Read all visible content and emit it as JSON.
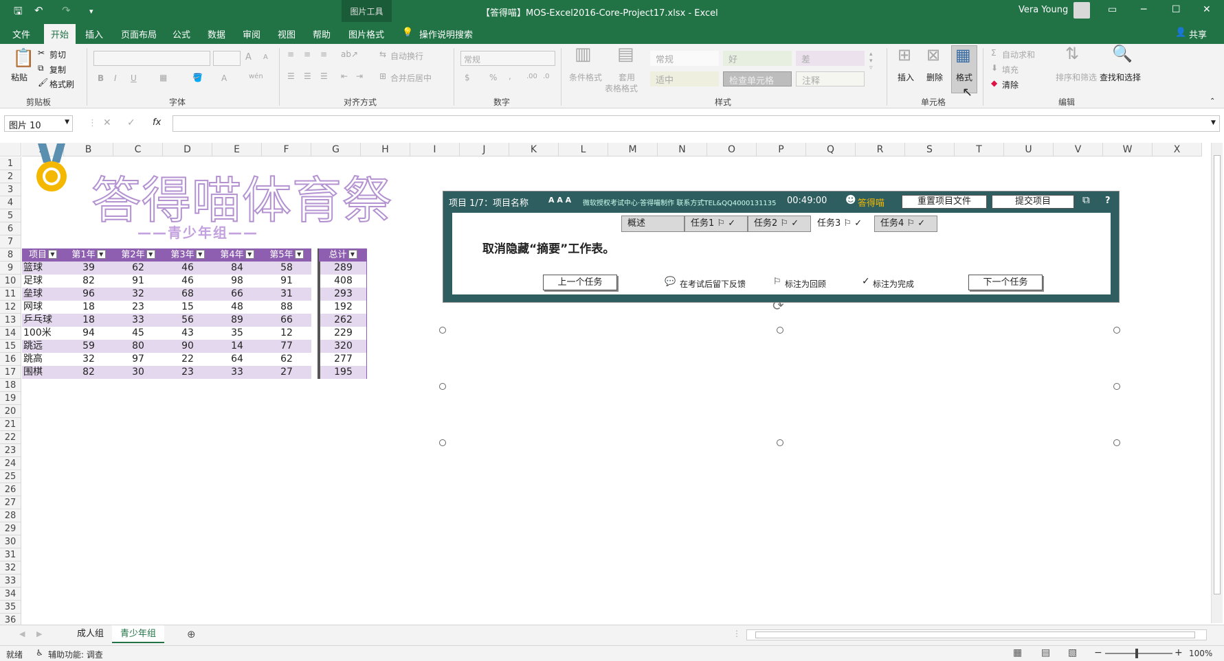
{
  "qat": {
    "save_icon": "save-icon",
    "undo_icon": "undo-icon",
    "redo_icon": "redo-icon",
    "customize": "▾"
  },
  "context_tab": {
    "label": "图片工具"
  },
  "document_title": "【答得喵】MOS-Excel2016-Core-Project17.xlsx  -  Excel",
  "user": {
    "name": "Vera Young"
  },
  "ribbon_tabs": [
    "文件",
    "开始",
    "插入",
    "页面布局",
    "公式",
    "数据",
    "审阅",
    "视图",
    "帮助",
    "图片格式"
  ],
  "tell_me": "操作说明搜索",
  "share": "共享",
  "clipboard": {
    "paste": "粘贴",
    "cut": "剪切",
    "copy": "复制",
    "format_painter": "格式刷",
    "group": "剪贴板"
  },
  "font": {
    "group": "字体",
    "bold": "B",
    "italic": "I",
    "underline": "U",
    "grow": "A",
    "shrink": "A",
    "color": "A",
    "phonetic": "wén"
  },
  "alignment": {
    "wrap": "自动换行",
    "merge": "合并后居中",
    "group": "对齐方式"
  },
  "number": {
    "format": "常规",
    "currency": "$",
    "percent": "%",
    "comma": ",",
    "group": "数字"
  },
  "styles": {
    "conditional": "条件格式",
    "table1": "套用",
    "table2": "表格格式",
    "group": "样式",
    "normal": "常规",
    "good": "好",
    "bad": "差",
    "neutral": "适中",
    "check": "检查单元格",
    "note": "注释"
  },
  "cells": {
    "insert": "插入",
    "delete": "删除",
    "format": "格式",
    "group": "单元格"
  },
  "editing": {
    "autosum": "自动求和",
    "fill": "填充",
    "clear": "清除",
    "sort": "排序和筛选",
    "find": "查找和选择",
    "group": "编辑"
  },
  "formula_bar": {
    "name_box": "图片 10",
    "fx": "fx",
    "cancel": "✕",
    "enter": "✓",
    "value": ""
  },
  "columns": [
    "A",
    "B",
    "C",
    "D",
    "E",
    "F",
    "G",
    "H",
    "I",
    "J",
    "K",
    "L",
    "M",
    "N",
    "O",
    "P",
    "Q",
    "R",
    "S",
    "T",
    "U",
    "V",
    "W",
    "X"
  ],
  "rows": [
    "1",
    "2",
    "3",
    "4",
    "5",
    "6",
    "7",
    "8",
    "9",
    "10",
    "11",
    "12",
    "13",
    "14",
    "15",
    "16",
    "17",
    "18",
    "19",
    "20",
    "21",
    "22",
    "23",
    "24",
    "25",
    "26",
    "27",
    "28",
    "29",
    "30",
    "31",
    "32",
    "33",
    "34",
    "35",
    "36"
  ],
  "banner": {
    "title": "答得喵体育祭",
    "subtitle": "——青少年组——",
    "medal_icon": "medal-icon"
  },
  "table": {
    "headers": [
      "项目",
      "第1年",
      "第2年",
      "第3年",
      "第4年",
      "第5年",
      "总计"
    ],
    "rows": [
      [
        "篮球",
        "39",
        "62",
        "46",
        "84",
        "58",
        "289"
      ],
      [
        "足球",
        "82",
        "91",
        "46",
        "98",
        "91",
        "408"
      ],
      [
        "垒球",
        "96",
        "32",
        "68",
        "66",
        "31",
        "293"
      ],
      [
        "网球",
        "18",
        "23",
        "15",
        "48",
        "88",
        "192"
      ],
      [
        "乒乓球",
        "18",
        "33",
        "56",
        "89",
        "66",
        "262"
      ],
      [
        "100米",
        "94",
        "45",
        "43",
        "35",
        "12",
        "229"
      ],
      [
        "跳远",
        "59",
        "80",
        "90",
        "14",
        "77",
        "320"
      ],
      [
        "跳高",
        "32",
        "97",
        "22",
        "64",
        "62",
        "277"
      ],
      [
        "围棋",
        "82",
        "30",
        "23",
        "33",
        "27",
        "195"
      ]
    ]
  },
  "task_panel": {
    "project": "项目 1/7：项目名称",
    "font_size": "A A A",
    "vendor": "微软授权考试中心·答得喵制作 联系方式TEL&QQ4000131135",
    "timer": "00:49:00",
    "brand": "答得喵",
    "reset": "重置项目文件",
    "submit": "提交项目",
    "tabs": [
      "概述",
      "任务1 ⚐ ✓",
      "任务2 ⚐ ✓",
      "任务3 ⚐ ✓",
      "任务4 ⚐ ✓"
    ],
    "instruction": "取消隐藏“摘要”工作表。",
    "prev": "上一个任务",
    "feedback": "在考试后留下反馈",
    "review": "标注为回顾",
    "complete": "标注为完成",
    "next": "下一个任务",
    "help": "?"
  },
  "sheet_tabs": [
    "成人组",
    "青少年组"
  ],
  "active_sheet": "青少年组",
  "status": {
    "ready": "就绪",
    "accessibility": "辅助功能: 调查",
    "zoom": "100%"
  }
}
